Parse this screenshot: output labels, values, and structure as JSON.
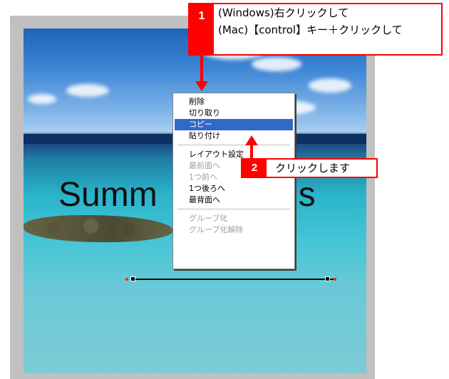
{
  "photo": {
    "text_left": "Summ",
    "text_right": "gs"
  },
  "context_menu": {
    "items": [
      {
        "label": "削除",
        "state": "enabled"
      },
      {
        "label": "切り取り",
        "state": "enabled"
      },
      {
        "label": "コピー",
        "state": "selected"
      },
      {
        "label": "貼り付け",
        "state": "enabled"
      },
      {
        "label": "レイアウト設定",
        "state": "enabled"
      },
      {
        "label": "最前面へ",
        "state": "disabled"
      },
      {
        "label": "1つ前へ",
        "state": "disabled"
      },
      {
        "label": "1つ後ろへ",
        "state": "enabled"
      },
      {
        "label": "最背面へ",
        "state": "enabled"
      },
      {
        "label": "グループ化",
        "state": "disabled"
      },
      {
        "label": "グループ化解除",
        "state": "disabled"
      }
    ]
  },
  "callouts": {
    "step1": {
      "number": "1",
      "line1": "(Windows)右クリックして",
      "line2": "(Mac)【control】キー＋クリックして"
    },
    "step2": {
      "number": "2",
      "text": "クリックします"
    }
  },
  "colors": {
    "callout": "#ff0000",
    "menu_highlight": "#3169c6"
  }
}
